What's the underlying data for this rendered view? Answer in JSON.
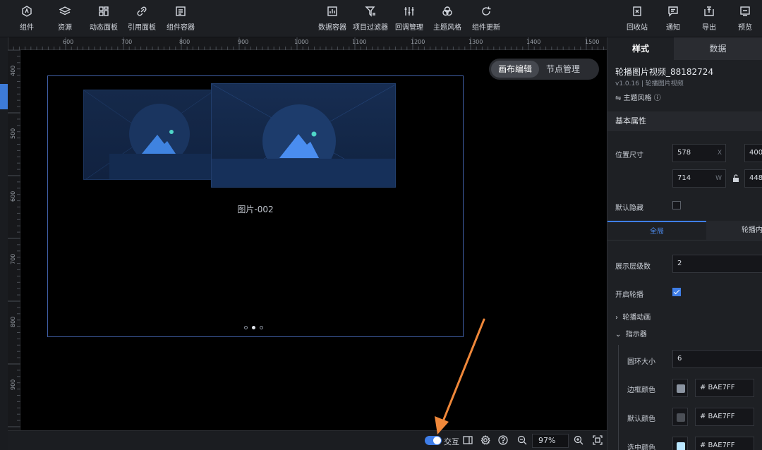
{
  "toolbar": {
    "left": [
      {
        "label": "组件",
        "icon": "component-icon"
      },
      {
        "label": "资源",
        "icon": "layers-icon"
      },
      {
        "label": "动态面板",
        "icon": "dynamic-panel-icon"
      },
      {
        "label": "引用面板",
        "icon": "link-icon"
      },
      {
        "label": "组件容器",
        "icon": "container-icon"
      }
    ],
    "center": [
      {
        "label": "数据容器",
        "icon": "chart-icon"
      },
      {
        "label": "项目过滤器",
        "icon": "filter-icon"
      },
      {
        "label": "回调管理",
        "icon": "sliders-icon"
      },
      {
        "label": "主题风格",
        "icon": "palette-icon"
      },
      {
        "label": "组件更新",
        "icon": "refresh-icon"
      }
    ],
    "right": [
      {
        "label": "回收站",
        "icon": "trash-icon"
      },
      {
        "label": "通知",
        "icon": "message-icon"
      },
      {
        "label": "导出",
        "icon": "export-icon"
      },
      {
        "label": "预览",
        "icon": "preview-icon"
      }
    ]
  },
  "ruler": {
    "h_ticks": [
      "600",
      "700",
      "800",
      "900",
      "1000",
      "1100",
      "1200",
      "1300",
      "1400",
      "1500"
    ],
    "v_ticks": [
      "400",
      "500",
      "600",
      "700",
      "800",
      "900"
    ]
  },
  "canvas": {
    "modes": [
      "画布编辑",
      "节点管理"
    ],
    "image_title": "图片-002"
  },
  "bottombar": {
    "interact_label": "交互",
    "zoom": "97%"
  },
  "panel": {
    "tabs": [
      "样式",
      "数据"
    ],
    "component_name": "轮播图片视频_88182724",
    "component_sub": "v1.0.16 | 轮播图片视频",
    "theme_label": "⇋ 主题风格 ⓘ",
    "section_basic": "基本属性",
    "pos_label": "位置尺寸",
    "x": "578",
    "x_suffix": "X",
    "y": "400",
    "w": "714",
    "w_suffix": "W",
    "h": "448",
    "hidden_label": "默认隐藏",
    "subtabs": [
      "全局",
      "轮播内"
    ],
    "levels_label": "展示层级数",
    "levels": "2",
    "autoplay_label": "开启轮播",
    "anim_label": "轮播动画",
    "indicator_label": "指示器",
    "ring_size_label": "圆环大小",
    "ring_size": "6",
    "border_color_label": "边框颜色",
    "border_color": "# BAE7FF",
    "default_color_label": "默认颜色",
    "default_color": "# BAE7FF",
    "selected_color_label": "选中颜色",
    "selected_color": "# BAE7FF"
  },
  "colors": {
    "accent": "#3f7ee8",
    "frame_border": "#4160a8",
    "annotation_arrow": "#f0883a"
  }
}
